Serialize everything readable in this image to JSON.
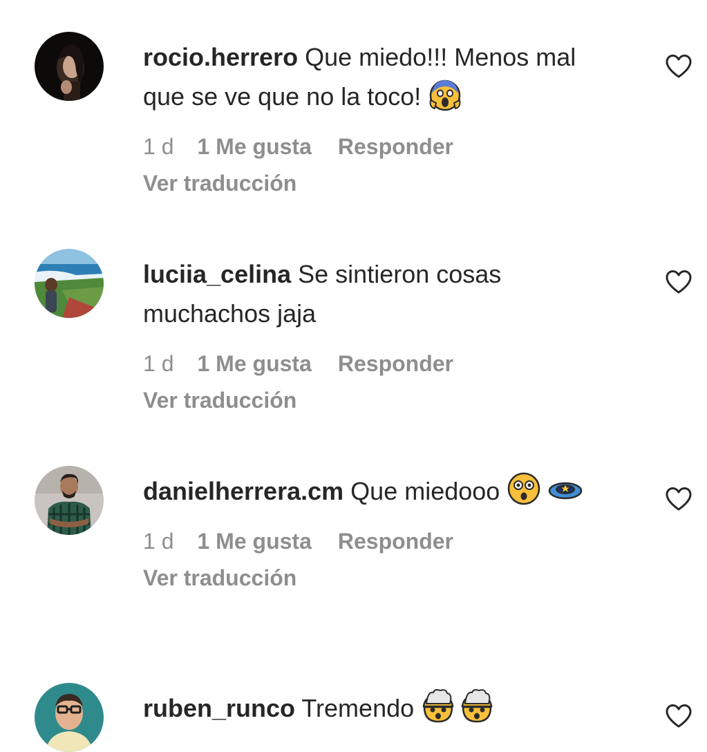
{
  "comments": [
    {
      "username": "rocio.herrero",
      "text": "Que miedo!!! Menos mal que se ve que no la toco!",
      "emojis": [
        "face-screaming-in-fear-emoji"
      ],
      "time": "1 d",
      "likes": "1 Me gusta",
      "reply": "Responder",
      "translate": "Ver traducción",
      "avatar": "avatar-woman-dark"
    },
    {
      "username": "luciia_celina",
      "text": "Se sintieron cosas muchachos jaja",
      "emojis": [],
      "time": "1 d",
      "likes": "1 Me gusta",
      "reply": "Responder",
      "translate": "Ver traducción",
      "avatar": "avatar-coast-landscape"
    },
    {
      "username": "danielherrera.cm",
      "text": "Que miedooo",
      "emojis": [
        "hushed-face-emoji",
        "dizzy-ufo-emoji"
      ],
      "time": "1 d",
      "likes": "1 Me gusta",
      "reply": "Responder",
      "translate": "Ver traducción",
      "avatar": "avatar-man-plaid"
    },
    {
      "username": "ruben_runco",
      "text": "Tremendo",
      "emojis": [
        "exploding-head-emoji",
        "exploding-head-emoji"
      ],
      "avatar": "avatar-man-glasses"
    }
  ],
  "icons": {
    "like": "heart-outline-icon"
  },
  "colors": {
    "text": "#262626",
    "secondary": "#8e8e8e",
    "background": "#ffffff"
  }
}
